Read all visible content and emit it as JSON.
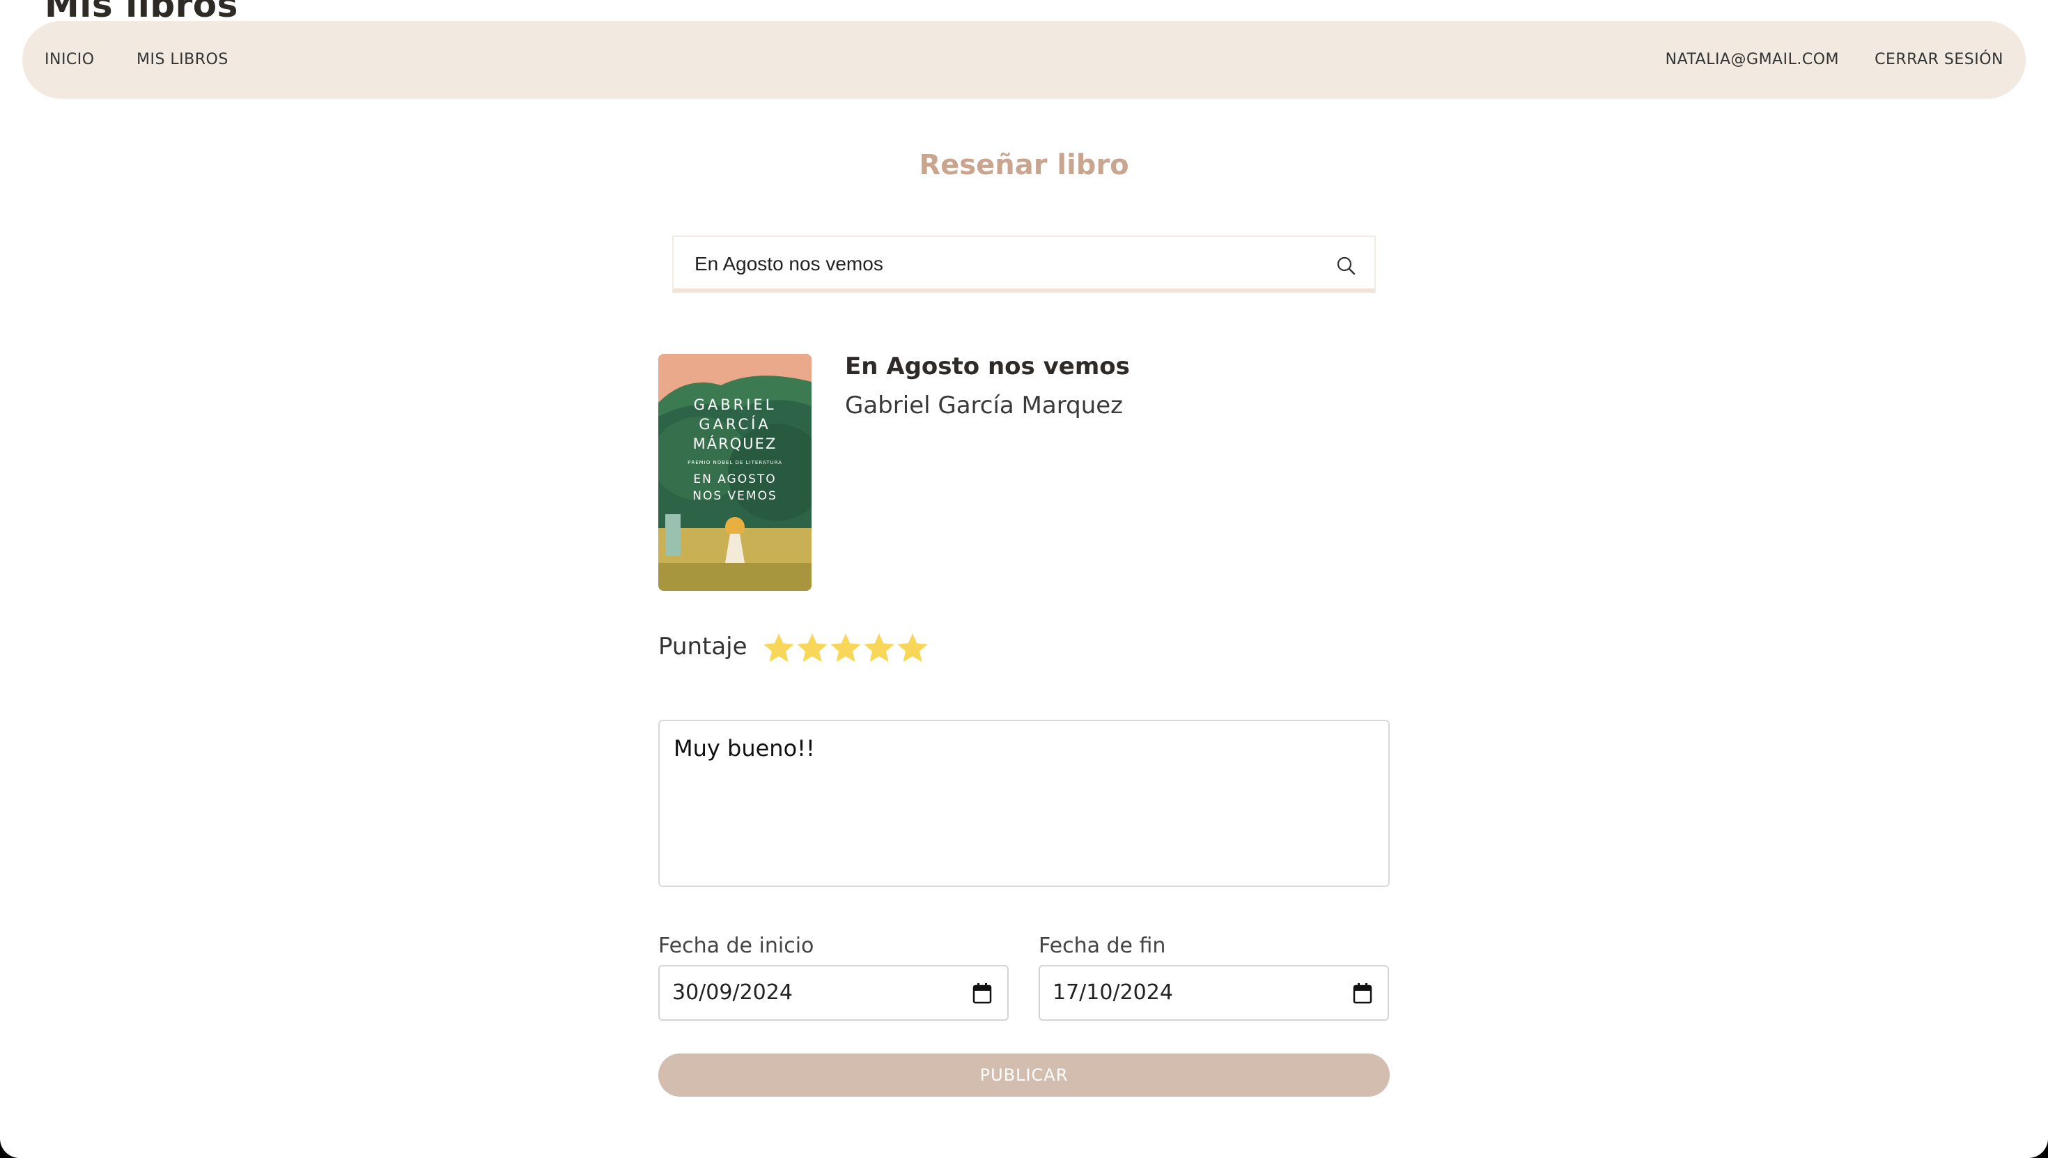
{
  "app": {
    "brand": "Mis libros"
  },
  "nav": {
    "inicio": "INICIO",
    "mis_libros": "MIS LIBROS",
    "email": "NATALIA@GMAIL.COM",
    "logout": "CERRAR SESIÓN"
  },
  "page": {
    "title": "Reseñar libro"
  },
  "search": {
    "value": "En Agosto nos vemos"
  },
  "book": {
    "title": "En Agosto nos vemos",
    "author": "Gabriel García Marquez",
    "cover": {
      "author_lines": [
        "GABRIEL",
        "GARCÍA",
        "MÁRQUEZ"
      ],
      "award": "PREMIO NOBEL DE LITERATURA",
      "title_lines": [
        "EN AGOSTO",
        "NOS VEMOS"
      ]
    }
  },
  "rating": {
    "label": "Puntaje",
    "value": 5,
    "max": 5,
    "color": "#f7d658"
  },
  "review": {
    "text": "Muy bueno!!"
  },
  "dates": {
    "start_label": "Fecha de inicio",
    "start_value": "30/09/2024",
    "end_label": "Fecha de fin",
    "end_value": "17/10/2024"
  },
  "actions": {
    "publish": "PUBLICAR"
  },
  "colors": {
    "navbar_bg": "#f2e9e0",
    "title": "#c9a590",
    "publish_bg": "#d3bdae"
  }
}
